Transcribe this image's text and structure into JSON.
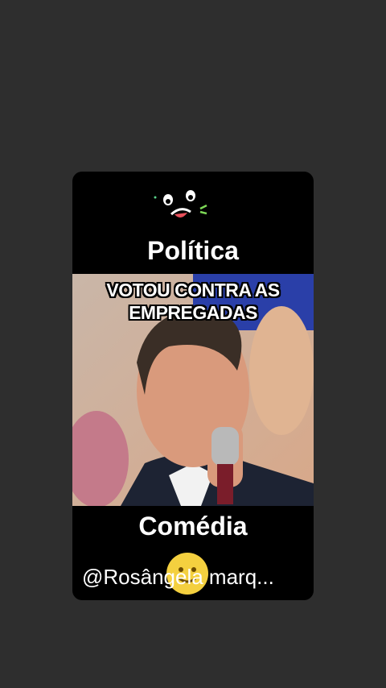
{
  "card": {
    "title_top": "Política",
    "caption_line1": "VOTOU CONTRA AS",
    "caption_line2": "EMPREGADAS",
    "title_bottom": "Comédia",
    "handle": "@Rosângela marq..."
  },
  "icons": {
    "sticker": "silly-face-sticker-icon",
    "emoji": "smiling-face-emoji-icon"
  },
  "colors": {
    "background": "#2e2e2e",
    "card": "#000000",
    "text": "#ffffff",
    "emoji": "#f4d03f"
  }
}
